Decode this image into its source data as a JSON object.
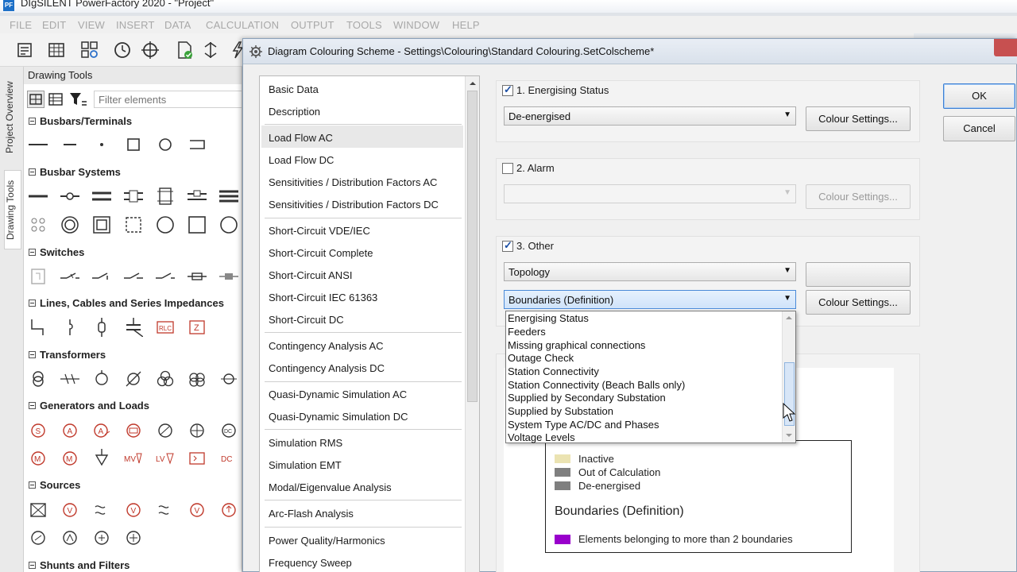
{
  "app": {
    "title": "DIgSILENT PowerFactory 2020 - \"Project\"",
    "logo": "PF"
  },
  "menu": [
    "FILE",
    "EDIT",
    "VIEW",
    "INSERT",
    "DATA",
    "CALCULATION",
    "OUTPUT",
    "TOOLS",
    "WINDOW",
    "HELP"
  ],
  "toolbar": {
    "icons": [
      "script-icon",
      "table-icon",
      "network-model-icon",
      "clock-icon",
      "crosshair-icon",
      "document-check-icon",
      "switch-icon",
      "flash-icon"
    ]
  },
  "vtabs": {
    "project_overview": "Project Overview",
    "drawing_tools": "Drawing Tools"
  },
  "drawing_tools": {
    "header": "Drawing Tools",
    "filter_placeholder": "Filter elements",
    "sections": [
      "Busbars/Terminals",
      "Busbar Systems",
      "Switches",
      "Lines, Cables and Series Impedances",
      "Transformers",
      "Generators and Loads",
      "Sources",
      "Shunts and Filters"
    ]
  },
  "dialog": {
    "title": "Diagram Colouring Scheme - Settings\\Colouring\\Standard Colouring.SetColscheme*",
    "nav": {
      "groups": [
        [
          "Basic Data",
          "Description"
        ],
        [
          "Load Flow AC",
          "Load Flow DC",
          "Sensitivities / Distribution Factors AC",
          "Sensitivities / Distribution Factors DC"
        ],
        [
          "Short-Circuit VDE/IEC",
          "Short-Circuit Complete",
          "Short-Circuit ANSI",
          "Short-Circuit IEC 61363",
          "Short-Circuit DC"
        ],
        [
          "Contingency Analysis AC",
          "Contingency Analysis DC"
        ],
        [
          "Quasi-Dynamic Simulation AC",
          "Quasi-Dynamic Simulation DC"
        ],
        [
          "Simulation RMS",
          "Simulation EMT",
          "Modal/Eigenvalue Analysis"
        ],
        [
          "Arc-Flash Analysis"
        ],
        [
          "Power Quality/Harmonics",
          "Frequency Sweep"
        ]
      ],
      "selected": "Load Flow AC"
    },
    "energising": {
      "label": "1. Energising Status",
      "checked": true,
      "value": "De-energised",
      "button": "Colour Settings..."
    },
    "alarm": {
      "label": "2. Alarm",
      "checked": false,
      "value": "",
      "button": "Colour Settings..."
    },
    "other": {
      "label": "3. Other",
      "checked": true,
      "value": "Topology",
      "button2": "",
      "sub_value": "Boundaries (Definition)",
      "button": "Colour Settings..."
    },
    "dropdown_options": [
      "Energising Status",
      "Feeders",
      "Missing graphical connections",
      "Outage Check",
      "Station Connectivity",
      "Station Connectivity (Beach Balls only)",
      "Supplied by Secondary Substation",
      "Supplied by Substation",
      "System Type AC/DC and Phases",
      "Voltage Levels"
    ],
    "ok": "OK",
    "cancel": "Cancel",
    "legend": {
      "items": [
        {
          "label": "Inactive",
          "color": "#ebe3b2"
        },
        {
          "label": "Out of Calculation",
          "color": "#7f7f7f"
        },
        {
          "label": "De-energised",
          "color": "#7f7f7f"
        }
      ],
      "title": "Boundaries (Definition)",
      "boundary_item": {
        "label": "Elements belonging to more than 2 boundaries",
        "color": "#9900cc"
      }
    }
  }
}
